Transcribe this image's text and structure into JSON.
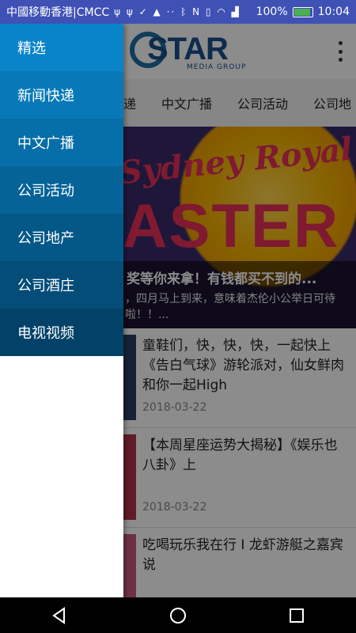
{
  "status_bar": {
    "carrier": "中國移動香港|CMCC",
    "icons": [
      "usb-icon",
      "usb-icon",
      "notification-icon",
      "app-icon",
      "more-icon",
      "bluetooth-icon",
      "nfc-icon",
      "vibrate-icon",
      "wifi-icon",
      "signal-icon"
    ],
    "battery": "100%",
    "battery_level": 100,
    "time": "10:04"
  },
  "toolbar": {
    "logo_word": "STAR",
    "logo_sub": "MEDIA GROUP"
  },
  "tabs": [
    "递",
    "中文广播",
    "公司活动",
    "公司地"
  ],
  "banner": {
    "script_text": "Sydney Royal",
    "big_text": "ASTER",
    "title": "奖等你来拿！有钱都买不到的...",
    "description": "，四月马上到来，意味着杰伦小公举日可待啦！！..."
  },
  "articles": [
    {
      "title": "童鞋们，快，快，快，一起快上《告白气球》游轮派对，仙女鲜肉和你一起High",
      "date": "2018-03-22"
    },
    {
      "title": "【本周星座运势大揭秘】《娱乐也八卦》上",
      "date": "2018-03-22"
    },
    {
      "title": "吃喝玩乐我在行 I 龙虾游艇之嘉宾说",
      "date": "2018-03-22"
    }
  ],
  "drawer": {
    "items": [
      {
        "label": "精选",
        "color": "#0a84c8"
      },
      {
        "label": "新闻快递",
        "color": "#0779b8"
      },
      {
        "label": "中文广播",
        "color": "#066ea8"
      },
      {
        "label": "公司活动",
        "color": "#056398"
      },
      {
        "label": "公司地产",
        "color": "#045888"
      },
      {
        "label": "公司酒庄",
        "color": "#034d78"
      },
      {
        "label": "电视视频",
        "color": "#034268"
      }
    ]
  },
  "colors": {
    "status_bar": "#3f51b5",
    "logo_blue": "#1a4f8a",
    "banner_pink": "#e8305a"
  }
}
